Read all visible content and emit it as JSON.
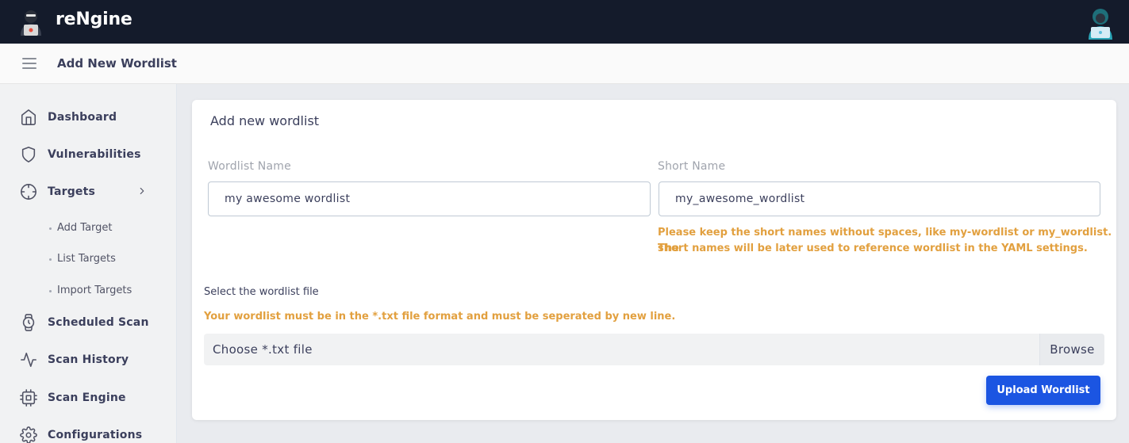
{
  "app": {
    "brand_name": "reNgine",
    "page_title": "Add New Wordlist"
  },
  "sidebar": {
    "items": [
      {
        "label": "Dashboard",
        "icon": "home-icon"
      },
      {
        "label": "Vulnerabilities",
        "icon": "shield-icon"
      },
      {
        "label": "Targets",
        "icon": "crosshair-icon"
      },
      {
        "label": "Scheduled Scan",
        "icon": "watch-icon"
      },
      {
        "label": "Scan History",
        "icon": "activity-icon"
      },
      {
        "label": "Scan Engine",
        "icon": "cpu-icon"
      },
      {
        "label": "Configurations",
        "icon": "gear-icon"
      }
    ],
    "target_subitems": [
      {
        "label": "Add Target"
      },
      {
        "label": "List Targets"
      },
      {
        "label": "Import Targets"
      }
    ]
  },
  "form": {
    "card_title": "Add new wordlist",
    "wordlist_name_label": "Wordlist Name",
    "wordlist_name_value": "my awesome wordlist",
    "short_name_label": "Short Name",
    "short_name_value": "my_awesome_wordlist",
    "short_name_help_line1": "Please keep the short names without spaces, like my-wordlist or my_wordlist. The",
    "short_name_help_line2": "short names will be later used to reference wordlist in the YAML settings.",
    "file_label": "Select the wordlist file",
    "file_help": "Your wordlist must be in the *.txt file format and must be seperated by new line.",
    "file_placeholder": "Choose *.txt file",
    "browse_label": "Browse",
    "upload_label": "Upload Wordlist"
  },
  "colors": {
    "topbar": "#141b2b",
    "accent": "#1b55e2",
    "warning": "#e2a03f"
  }
}
